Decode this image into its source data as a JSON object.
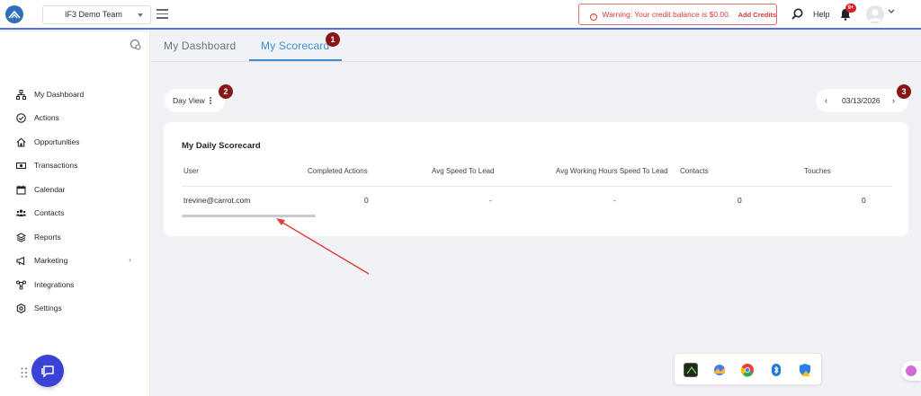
{
  "header": {
    "team_select": "IF3 Demo Team",
    "warning_text": "Warning: Your credit balance is $0.00.",
    "add_credits": "Add Credits",
    "help": "Help",
    "notification_badge": "9+",
    "warning_color": "#d93b3b",
    "accent": "#5b6ee1"
  },
  "sidebar": {
    "items": [
      {
        "label": "My Dashboard",
        "icon": "sitemap-icon"
      },
      {
        "label": "Actions",
        "icon": "check-circle-icon"
      },
      {
        "label": "Opportunities",
        "icon": "home-icon"
      },
      {
        "label": "Transactions",
        "icon": "money-icon"
      },
      {
        "label": "Calendar",
        "icon": "calendar-icon"
      },
      {
        "label": "Contacts",
        "icon": "users-icon"
      },
      {
        "label": "Reports",
        "icon": "layers-icon"
      },
      {
        "label": "Marketing",
        "icon": "megaphone-icon"
      },
      {
        "label": "Integrations",
        "icon": "nodes-icon"
      },
      {
        "label": "Settings",
        "icon": "gear-icon"
      }
    ],
    "marketing_chevron": "›"
  },
  "tabs": [
    {
      "label": "My Dashboard",
      "active": false
    },
    {
      "label": "My Scorecard",
      "active": true
    }
  ],
  "callouts": [
    "1",
    "2",
    "3"
  ],
  "controls": {
    "day_view": "Day View",
    "date": "03/13/2026",
    "prev": "‹",
    "next": "›"
  },
  "scorecard": {
    "title": "My Daily Scorecard",
    "columns": [
      "User",
      "Completed Actions",
      "Avg Speed To Lead",
      "Avg Working Hours Speed To Lead",
      "Contacts",
      "Touches"
    ],
    "rows": [
      [
        "trevine@carrot.com",
        "0",
        "-",
        "-",
        "0",
        "0"
      ]
    ]
  },
  "taskbar_apps": [
    "terminal-app-icon",
    "photos-app-icon",
    "chrome-app-icon",
    "bluetooth-app-icon",
    "security-app-icon"
  ]
}
